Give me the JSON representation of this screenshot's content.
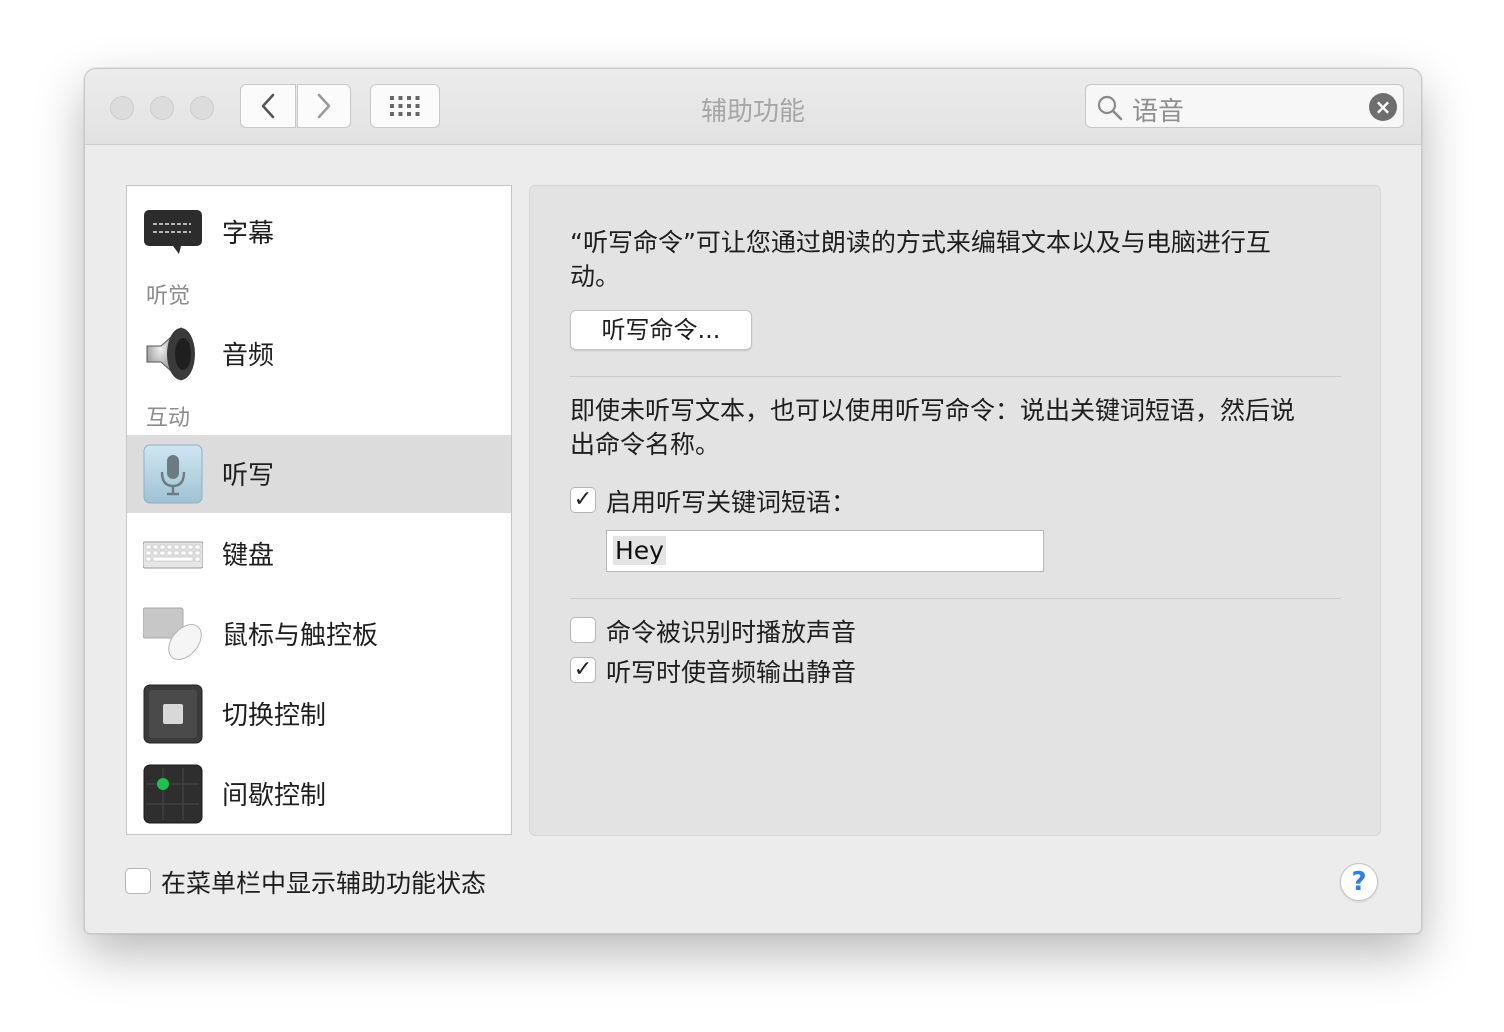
{
  "window": {
    "title": "辅助功能"
  },
  "search": {
    "value": "语音",
    "clear_symbol": "×"
  },
  "sidebar": {
    "items": [
      {
        "label": "字幕",
        "icon": "captions-icon"
      },
      {
        "label": "音频",
        "icon": "speaker-icon"
      },
      {
        "label": "听写",
        "icon": "microphone-icon",
        "selected": true
      },
      {
        "label": "键盘",
        "icon": "keyboard-icon"
      },
      {
        "label": "鼠标与触控板",
        "icon": "mouse-trackpad-icon"
      },
      {
        "label": "切换控制",
        "icon": "switch-control-icon"
      },
      {
        "label": "间歇控制",
        "icon": "dwell-control-icon"
      }
    ],
    "sections": [
      "听觉",
      "互动"
    ]
  },
  "pane": {
    "intro_line1": "“听写命令”可让您通过朗读的方式来编辑文本以及与电脑进行互",
    "intro_line2": "动。",
    "commands_button": "听写命令...",
    "keyword_line1": "即使未听写文本，也可以使用听写命令：说出关键词短语，然后说",
    "keyword_line2": "出命令名称。",
    "enable_keyword_label": "启用听写关键词短语：",
    "enable_keyword_checked": true,
    "keyword_value": "Hey",
    "play_sound_label": "命令被识别时播放声音",
    "play_sound_checked": false,
    "mute_audio_label": "听写时使音频输出静音",
    "mute_audio_checked": true,
    "check_mark": "✓"
  },
  "footer": {
    "show_status_label": "在菜单栏中显示辅助功能状态",
    "show_status_checked": false,
    "help_label": "?"
  }
}
